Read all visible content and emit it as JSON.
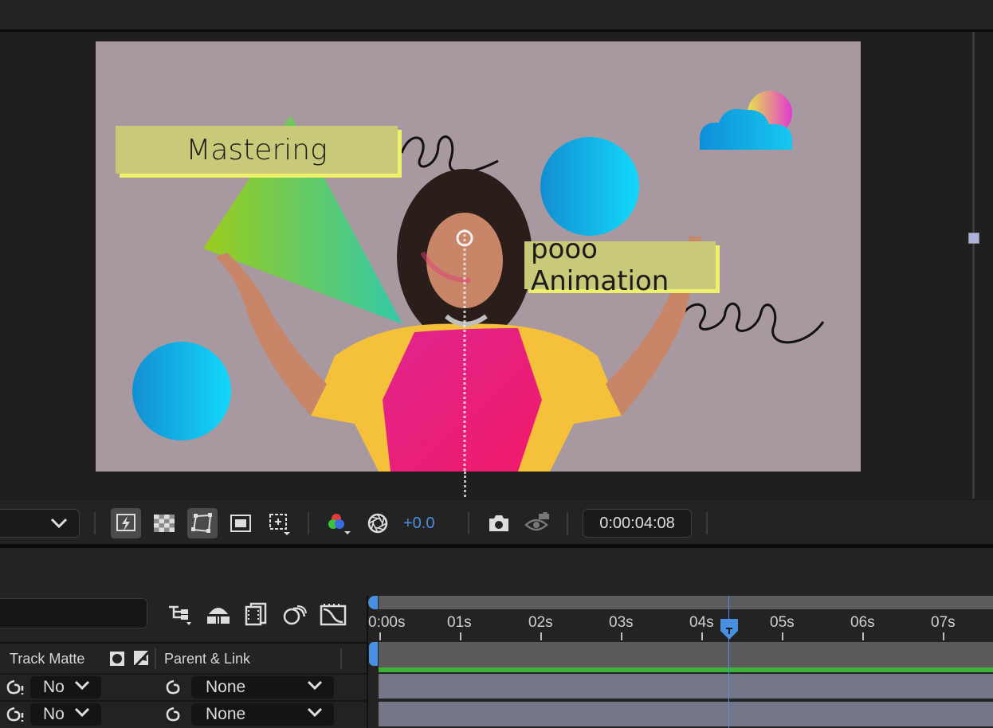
{
  "composition": {
    "title_line1": "Mastering",
    "title_line2": "pooo Animation"
  },
  "viewer_controls": {
    "exposure": "+0.0",
    "timecode": "0:00:04:08"
  },
  "ruler": {
    "ticks": [
      "0:00s",
      "01s",
      "02s",
      "03s",
      "04s",
      "05s",
      "06s",
      "07s"
    ]
  },
  "layer_columns": {
    "track_matte": "Track Matte",
    "parent_link": "Parent & Link"
  },
  "layers": [
    {
      "matte": "No",
      "parent": "None"
    },
    {
      "matte": "No",
      "parent": "None"
    }
  ],
  "colors": {
    "accent_blue": "#4a90e2",
    "label_green": "#3db33a",
    "track_fill": "#757588"
  },
  "icons": {
    "fast_previews": "lightning-icon",
    "transparency_grid": "checkerboard-icon",
    "mask_path": "mask-path-icon",
    "region_of_interest": "roi-icon",
    "target_region": "target-region-icon",
    "channel": "rgb-channel-icon",
    "exposure": "aperture-icon",
    "snapshot": "camera-icon",
    "show_snapshot": "eye-snapshot-icon"
  }
}
